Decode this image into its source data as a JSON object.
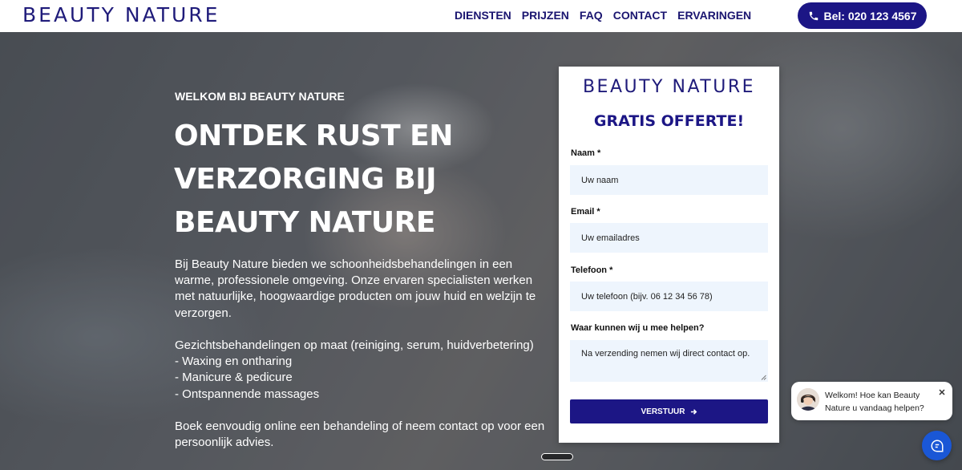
{
  "header": {
    "logo": "BEAUTY NATURE",
    "nav": [
      "DIENSTEN",
      "PRIJZEN",
      "FAQ",
      "CONTACT",
      "ERVARINGEN"
    ],
    "call_button": "Bel: 020 123 4567",
    "call_icon": "phone-icon"
  },
  "hero": {
    "welcome": "WELKOM BIJ BEAUTY NATURE",
    "headline_lines": [
      "ONTDEK RUST EN",
      "VERZORGING BIJ",
      "BEAUTY NATURE"
    ],
    "intro": "Bij Beauty Nature bieden we schoonheidsbehandelingen in een warme, professionele omgeving. Onze ervaren specialisten werken met natuurlijke, hoogwaardige producten om jouw huid en welzijn te verzorgen.",
    "services": [
      "Gezichtsbehandelingen op maat (reiniging, serum, huidverbetering)",
      "- Waxing en ontharing",
      "- Manicure & pedicure",
      "- Ontspannende massages"
    ],
    "booking": "Boek eenvoudig online een behandeling of neem contact op voor een persoonlijk advies."
  },
  "form": {
    "logo": "BEAUTY NATURE",
    "title": "GRATIS OFFERTE!",
    "name_label": "Naam *",
    "name_placeholder": "Uw naam",
    "email_label": "Email *",
    "email_placeholder": "Uw emailadres",
    "phone_label": "Telefoon *",
    "phone_placeholder": "Uw telefoon (bijv. 06 12 34 56 78)",
    "message_label": "Waar kunnen wij u mee helpen?",
    "message_placeholder": "Na verzending nemen wij direct contact op.",
    "submit_label": "VERSTUUR",
    "submit_icon": "arrow-right-icon"
  },
  "chat": {
    "message": "Welkom! Hoe kan Beauty Nature u vandaag helpen?",
    "close_icon": "close-icon",
    "launcher_icon": "chat-icon"
  },
  "colors": {
    "brand": "#1c1685",
    "input_bg": "#eef5fd",
    "chat_launcher": "#1a57d6"
  }
}
